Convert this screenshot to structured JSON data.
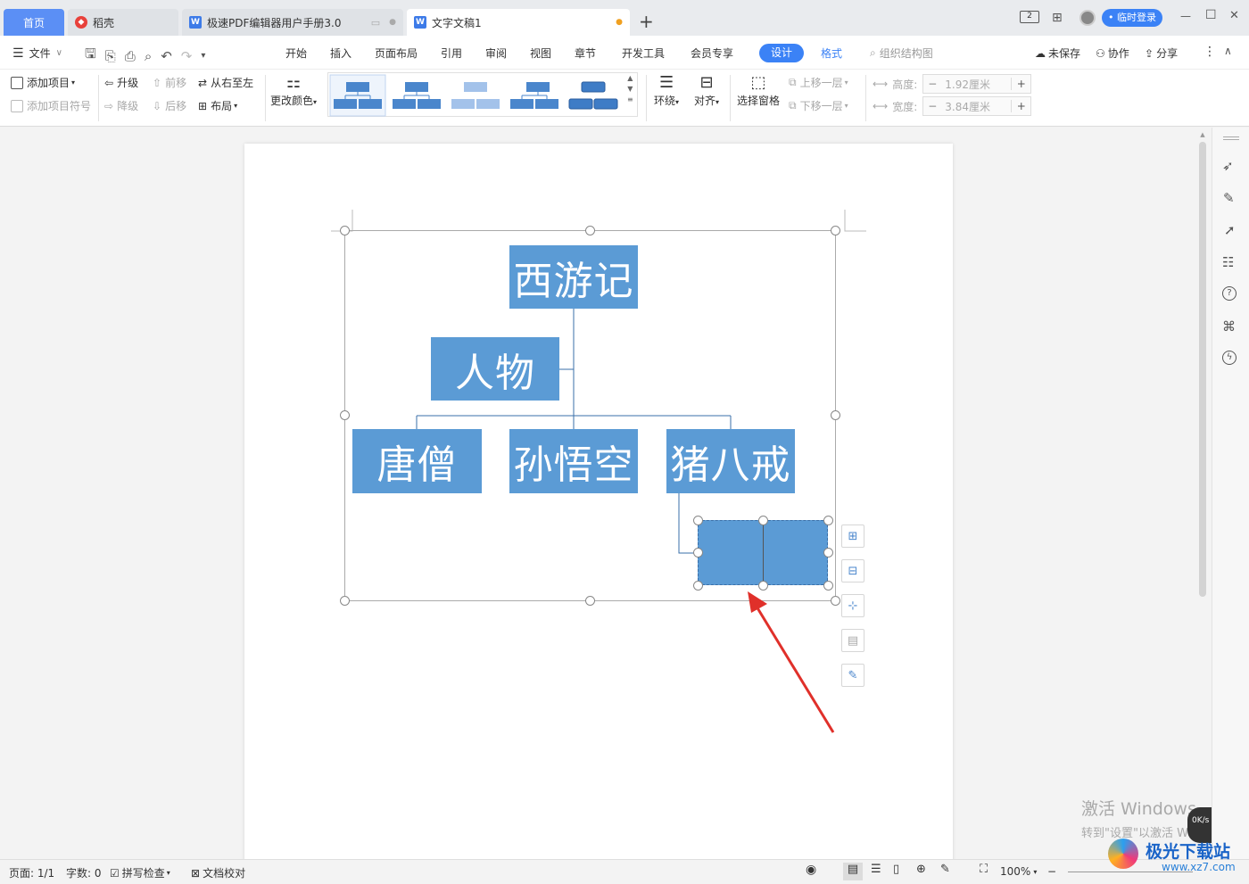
{
  "tabs": {
    "home": "首页",
    "wps": "稻壳",
    "pdf_doc": "极速PDF编辑器用户手册3.0",
    "active_doc": "文字文稿1",
    "new_tab": "+"
  },
  "titlebar": {
    "login_button": "• 临时登录",
    "minimize": "—",
    "maximize": "☐",
    "close": "✕"
  },
  "menubar": {
    "file": "文件",
    "items": [
      "开始",
      "插入",
      "页面布局",
      "引用",
      "审阅",
      "视图",
      "章节",
      "开发工具",
      "会员专享"
    ],
    "design": "设计",
    "format": "格式",
    "search_placeholder": "组织结构图",
    "unsaved": "未保存",
    "collaborate": "协作",
    "share": "分享"
  },
  "ribbon": {
    "add_item": "添加项目",
    "add_item_symbol": "添加项目符号",
    "promote": "升级",
    "demote": "降级",
    "move_forward": "前移",
    "move_backward": "后移",
    "right_to_left": "从右至左",
    "layout": "布局",
    "change_color": "更改颜色",
    "wrap": "环绕",
    "align": "对齐",
    "selection_pane": "选择窗格",
    "bring_forward": "上移一层",
    "send_backward": "下移一层",
    "height_label": "高度:",
    "height_value": "1.92厘米",
    "width_label": "宽度:",
    "width_value": "3.84厘米"
  },
  "orgchart": {
    "root": "西游记",
    "assistant": "人物",
    "children": [
      "唐僧",
      "孙悟空",
      "猪八戒"
    ]
  },
  "watermark": {
    "line1": "激活 Windows",
    "line2": "转到\"设置\"以激活 Windows。"
  },
  "logo": {
    "text": "极光下载站",
    "url": "www.xz7.com"
  },
  "net_speed": "0K/s",
  "statusbar": {
    "page": "页面: 1/1",
    "word_count": "字数: 0",
    "spell_check": "拼写检查",
    "doc_proof": "文档校对",
    "zoom": "100%"
  },
  "colors": {
    "accent": "#3b82f6",
    "node_fill": "#5b9bd5",
    "arrow": "#e0302a"
  }
}
